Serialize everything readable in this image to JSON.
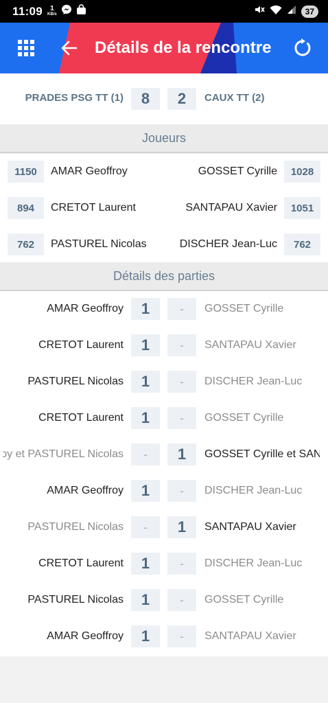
{
  "status_bar": {
    "time": "11:09",
    "data_rate_value": "1",
    "data_rate_unit": "KB/s",
    "battery": "37",
    "icons": [
      "messenger-icon",
      "shopping-bag-icon",
      "mute-icon",
      "wifi-icon",
      "signal-icon",
      "battery-icon"
    ]
  },
  "app_bar": {
    "title": "Détails de la rencontre",
    "colors": {
      "bar": "#1e6ff0",
      "red_stripe": "#f03a52",
      "navy_stripe": "#1c2fb0"
    }
  },
  "match": {
    "home_team": "PRADES PSG TT (1)",
    "home_score": "8",
    "away_score": "2",
    "away_team": "CAUX TT (2)"
  },
  "players_section": {
    "title": "Joueurs",
    "rows": [
      {
        "home_points": "1150",
        "home_name": "AMAR Geoffroy",
        "away_name": "GOSSET Cyrille",
        "away_points": "1028"
      },
      {
        "home_points": "894",
        "home_name": "CRETOT Laurent",
        "away_name": "SANTAPAU Xavier",
        "away_points": "1051"
      },
      {
        "home_points": "762",
        "home_name": "PASTUREL Nicolas",
        "away_name": "DISCHER Jean-Luc",
        "away_points": "762"
      }
    ]
  },
  "games_section": {
    "title": "Détails des parties",
    "rows": [
      {
        "home": "AMAR Geoffroy",
        "home_score": "1",
        "away_score": "-",
        "away": "GOSSET Cyrille"
      },
      {
        "home": "CRETOT Laurent",
        "home_score": "1",
        "away_score": "-",
        "away": "SANTAPAU Xavier"
      },
      {
        "home": "PASTUREL Nicolas",
        "home_score": "1",
        "away_score": "-",
        "away": "DISCHER Jean-Luc"
      },
      {
        "home": "CRETOT Laurent",
        "home_score": "1",
        "away_score": "-",
        "away": "GOSSET Cyrille"
      },
      {
        "home": "AMAR Geoffroy et PASTUREL Nicolas",
        "home_score": "-",
        "away_score": "1",
        "away": "GOSSET Cyrille et SANTAPAU Xavier"
      },
      {
        "home": "AMAR Geoffroy",
        "home_score": "1",
        "away_score": "-",
        "away": "DISCHER Jean-Luc"
      },
      {
        "home": "PASTUREL Nicolas",
        "home_score": "-",
        "away_score": "1",
        "away": "SANTAPAU Xavier"
      },
      {
        "home": "CRETOT Laurent",
        "home_score": "1",
        "away_score": "-",
        "away": "DISCHER Jean-Luc"
      },
      {
        "home": "PASTUREL Nicolas",
        "home_score": "1",
        "away_score": "-",
        "away": "GOSSET Cyrille"
      },
      {
        "home": "AMAR Geoffroy",
        "home_score": "1",
        "away_score": "-",
        "away": "SANTAPAU Xavier"
      }
    ]
  }
}
